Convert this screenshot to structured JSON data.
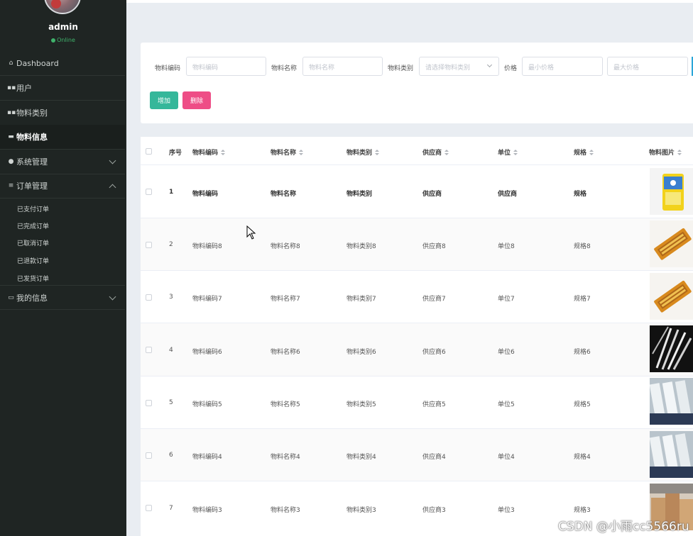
{
  "user": {
    "name": "admin",
    "status": "Online"
  },
  "menu": [
    {
      "label": "Dashboard",
      "icon": "home-icon"
    },
    {
      "label": "用户",
      "icon": "grid-icon"
    },
    {
      "label": "物料类别",
      "icon": "grid-icon"
    },
    {
      "label": "物料信息",
      "icon": "card-icon"
    },
    {
      "label": "系统管理",
      "icon": "person-icon"
    },
    {
      "label": "订单管理",
      "icon": "list-icon"
    },
    {
      "label": "我的信息",
      "icon": "folder-icon"
    }
  ],
  "order_submenu": [
    "已支付订单",
    "已完成订单",
    "已取消订单",
    "已退款订单",
    "已发货订单"
  ],
  "filters": {
    "code_label": "物料编码",
    "code_placeholder": "物料编码",
    "name_label": "物料名称",
    "name_placeholder": "物料名称",
    "category_label": "物料类别",
    "category_placeholder": "请选择物料类别",
    "price_label": "价格",
    "min_price_placeholder": "最小价格",
    "max_price_placeholder": "最大价格"
  },
  "buttons": {
    "add": "增加",
    "delete": "删除"
  },
  "table": {
    "headers": [
      "序号",
      "物料编码",
      "物料名称",
      "物料类别",
      "供应商",
      "单位",
      "规格",
      "物料图片"
    ],
    "rows": [
      {
        "index": "1",
        "code": "物料编码",
        "name": "物料名称",
        "category": "物料类别",
        "supplier": "供应商",
        "unit": "供应商",
        "spec": "规格",
        "image": "rice-bag"
      },
      {
        "index": "2",
        "code": "物料编码8",
        "name": "物料名称8",
        "category": "物料类别8",
        "supplier": "供应商8",
        "unit": "单位8",
        "spec": "规格8",
        "image": "orange-tray"
      },
      {
        "index": "3",
        "code": "物料编码7",
        "name": "物料名称7",
        "category": "物料类别7",
        "supplier": "供应商7",
        "unit": "单位7",
        "spec": "规格7",
        "image": "orange-tray"
      },
      {
        "index": "4",
        "code": "物料编码6",
        "name": "物料名称6",
        "category": "物料类别6",
        "supplier": "供应商6",
        "unit": "单位6",
        "spec": "规格6",
        "image": "straws-dark"
      },
      {
        "index": "5",
        "code": "物料编码5",
        "name": "物料名称5",
        "category": "物料类别5",
        "supplier": "供应商5",
        "unit": "单位5",
        "spec": "规格5",
        "image": "cutlery-packs"
      },
      {
        "index": "6",
        "code": "物料编码4",
        "name": "物料名称4",
        "category": "物料类别4",
        "supplier": "供应商4",
        "unit": "单位4",
        "spec": "规格4",
        "image": "cutlery-packs"
      },
      {
        "index": "7",
        "code": "物料编码3",
        "name": "物料名称3",
        "category": "物料类别3",
        "supplier": "供应商3",
        "unit": "单位3",
        "spec": "规格3",
        "image": "paper-bags"
      }
    ]
  },
  "watermark": "CSDN @小雨cc5566ru"
}
